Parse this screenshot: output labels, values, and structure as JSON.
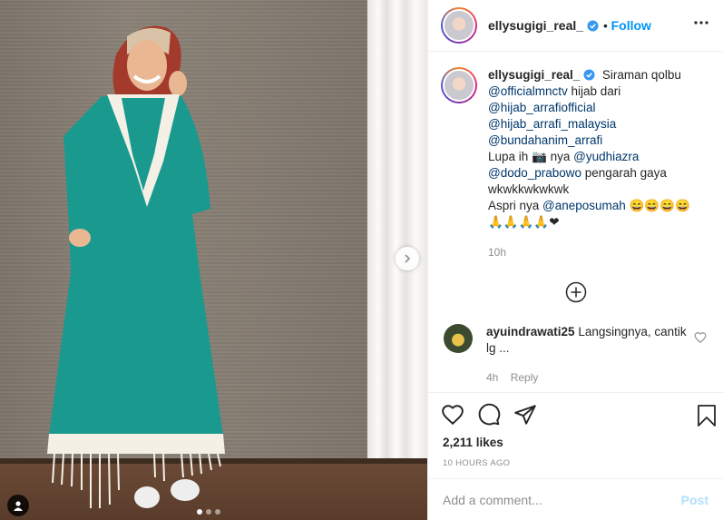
{
  "header": {
    "username": "ellysugigi_real_",
    "separator": "•",
    "follow_label": "Follow"
  },
  "caption": {
    "username": "ellysugigi_real_",
    "lines": [
      {
        "parts": [
          {
            "t": "Siraman qolbu",
            "m": false
          }
        ]
      },
      {
        "parts": [
          {
            "t": "@officialmnctv",
            "m": true
          },
          {
            "t": " hijab dari",
            "m": false
          }
        ]
      },
      {
        "parts": [
          {
            "t": "@hijab_arrafiofficial",
            "m": true
          }
        ]
      },
      {
        "parts": [
          {
            "t": "@hijab_arrafi_malaysia",
            "m": true
          }
        ]
      },
      {
        "parts": [
          {
            "t": "@bundahanim_arrafi",
            "m": true
          }
        ]
      },
      {
        "parts": [
          {
            "t": "Lupa ih 📷 nya ",
            "m": false
          },
          {
            "t": "@yudhiazra",
            "m": true
          }
        ]
      },
      {
        "parts": [
          {
            "t": "@dodo_prabowo",
            "m": true
          },
          {
            "t": " pengarah gaya",
            "m": false
          }
        ]
      },
      {
        "parts": [
          {
            "t": "wkwkkwkwkwk",
            "m": false
          }
        ]
      },
      {
        "parts": [
          {
            "t": "Aspri nya ",
            "m": false
          },
          {
            "t": "@aneposumah",
            "m": true
          },
          {
            "t": " 😄😄😄😄",
            "m": false
          }
        ]
      },
      {
        "parts": [
          {
            "t": "🙏🙏🙏🙏❤",
            "m": false
          }
        ]
      }
    ],
    "time": "10h"
  },
  "comment": {
    "username": "ayuindrawati25",
    "text": "Langsingnya, cantik lg ...",
    "time": "4h",
    "reply_label": "Reply"
  },
  "likes": "2,211 likes",
  "post_time": "10 HOURS AGO",
  "add_comment": {
    "placeholder": "Add a comment...",
    "post_label": "Post"
  },
  "carousel": {
    "count": 3,
    "active": 0
  },
  "colors": {
    "accent": "#0095f6",
    "mention": "#00376b",
    "muted": "#8e8e8e",
    "post_disabled": "#b2dffc",
    "dress": "#1a9a8f"
  },
  "icons": [
    "verified-badge-icon",
    "more-options-icon",
    "chevron-right-icon",
    "user-tag-icon",
    "load-more-icon",
    "heart-icon",
    "comment-icon",
    "share-icon",
    "bookmark-icon"
  ]
}
